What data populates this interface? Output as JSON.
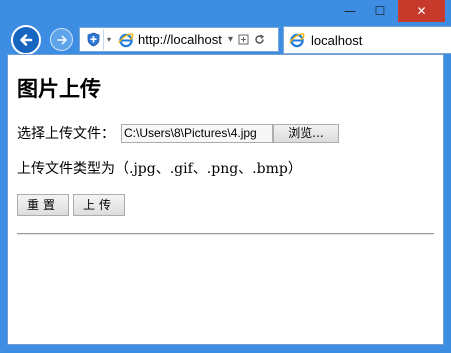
{
  "window": {
    "caption_buttons": {
      "minimize": "—",
      "maximize": "☐",
      "close": "✕"
    }
  },
  "nav": {
    "address": "http://localhost",
    "tab_title": "localhost",
    "icons": [
      "back-arrow-icon",
      "forward-arrow-icon",
      "shield-icon",
      "ie-logo-icon",
      "compatibility-view-icon",
      "refresh-icon"
    ]
  },
  "page": {
    "title": "图片上传",
    "file_label": "选择上传文件：",
    "file_value": "C:\\Users\\8\\Pictures\\4.jpg",
    "browse_label": "浏览...",
    "types_text": "上传文件类型为（.jpg、.gif、.png、.bmp）",
    "reset_label": "重置",
    "upload_label": "上传"
  }
}
